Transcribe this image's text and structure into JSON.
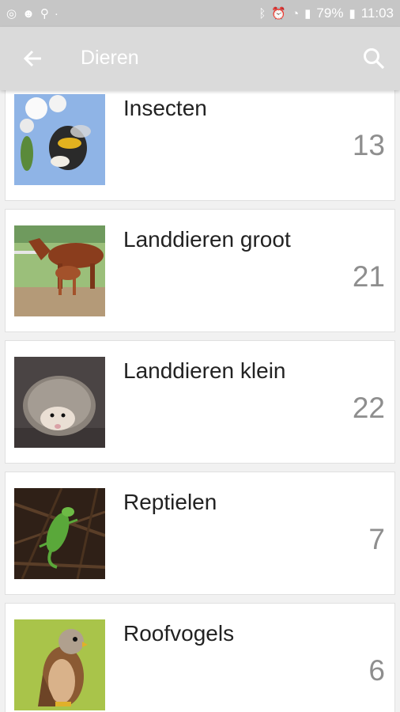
{
  "status_bar": {
    "battery": "79%",
    "time": "11:03",
    "left_icons": [
      "settings-circle-icon",
      "smile-icon",
      "pin-icon",
      "dot-icon"
    ],
    "right_icons": [
      "bluetooth-icon",
      "alarm-icon",
      "wifi-icon",
      "signal-icon",
      "battery-icon"
    ]
  },
  "appbar": {
    "title": "Dieren",
    "back_icon": "arrow-left-icon",
    "search_icon": "search-icon"
  },
  "categories": [
    {
      "name": "Insecten",
      "count": "13"
    },
    {
      "name": "Landdieren groot",
      "count": "21"
    },
    {
      "name": "Landdieren klein",
      "count": "22"
    },
    {
      "name": "Reptielen",
      "count": "7"
    },
    {
      "name": "Roofvogels",
      "count": "6"
    }
  ],
  "colors": {
    "status_bar_bg": "#c6c6c6",
    "appbar_bg": "#dadada",
    "list_bg": "#f1f1f1",
    "count_text": "#8e8e8e"
  }
}
